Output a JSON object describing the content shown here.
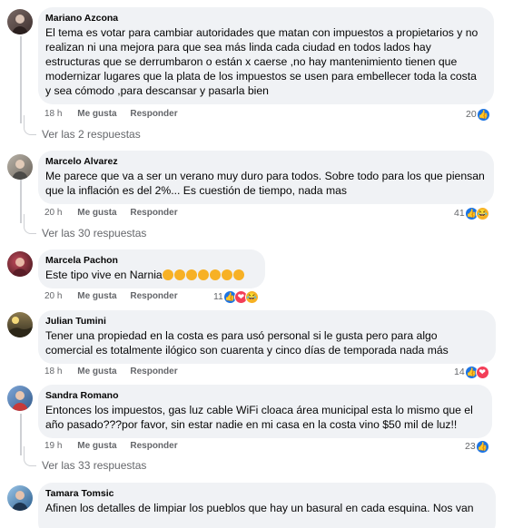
{
  "comments": [
    {
      "author": "Mariano Azcona",
      "text": "El tema es votar para cambiar autoridades que matan con impuestos a propietarios y no realizan ni una mejora para que sea más linda cada ciudad en todos lados hay estructuras que se derrumbaron o están x caerse ,no hay mantenimiento tienen que modernizar lugares que la plata de los impuestos se usen para embellecer toda la costa y sea cómodo ,para descansar y pasarla bien",
      "time": "18 h",
      "like": "Me gusta",
      "reply": "Responder",
      "reactions_count": "20",
      "reactions": [
        "like-icon"
      ],
      "replies": "Ver las 2 respuestas"
    },
    {
      "author": "Marcelo Alvarez",
      "text": "Me parece que va a ser un verano muy duro para todos. Sobre todo para los que piensan que la inflación es del 2%... Es cuestión de tiempo, nada mas",
      "time": "20 h",
      "like": "Me gusta",
      "reply": "Responder",
      "reactions_count": "41",
      "reactions": [
        "like-icon",
        "haha-icon"
      ],
      "replies": "Ver las 30 respuestas"
    },
    {
      "author": "Marcela Pachon",
      "text": "Este tipo vive en Narnia",
      "emoji_count": 7,
      "time": "20 h",
      "like": "Me gusta",
      "reply": "Responder",
      "reactions_count": "11",
      "reactions": [
        "like-icon",
        "love-icon",
        "haha-icon"
      ]
    },
    {
      "author": "Julian Tumini",
      "text": "Tener una propiedad en la costa es para usó personal si le gusta pero para algo comercial es totalmente ilógico son cuarenta y cinco días de temporada nada más",
      "time": "18 h",
      "like": "Me gusta",
      "reply": "Responder",
      "reactions_count": "14",
      "reactions": [
        "like-icon",
        "love-icon"
      ]
    },
    {
      "author": "Sandra Romano",
      "text": "Entonces los impuestos, gas luz cable WiFi cloaca área municipal esta lo mismo que el año pasado???por favor, sin estar nadie en mi casa en la costa vino $50 mil de luz!!",
      "time": "19 h",
      "like": "Me gusta",
      "reply": "Responder",
      "reactions_count": "23",
      "reactions": [
        "like-icon"
      ],
      "replies": "Ver las 33 respuestas"
    },
    {
      "author": "Tamara Tomsic",
      "text": "Afinen los detalles de limpiar los pueblos que hay un basural en cada esquina. Nos van"
    }
  ],
  "colors": {
    "bubble": "#f0f2f5",
    "meta": "#65676b",
    "like": "#1b74e4",
    "love": "#f33e58",
    "haha": "#f7b125"
  }
}
